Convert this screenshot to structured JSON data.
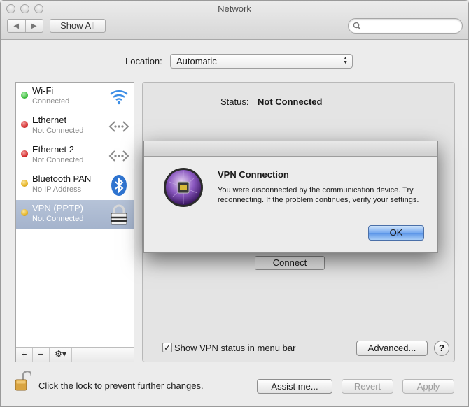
{
  "window": {
    "title": "Network"
  },
  "toolbar": {
    "back_glyph": "◀",
    "forward_glyph": "▶",
    "show_all": "Show All",
    "search_placeholder": ""
  },
  "location": {
    "label": "Location:",
    "value": "Automatic"
  },
  "services": [
    {
      "name": "Wi-Fi",
      "status": "Connected",
      "dot_color": "#3fbf3f",
      "icon": "wifi-icon"
    },
    {
      "name": "Ethernet",
      "status": "Not Connected",
      "dot_color": "#d62d2d",
      "icon": "ethernet-icon"
    },
    {
      "name": "Ethernet 2",
      "status": "Not Connected",
      "dot_color": "#d62d2d",
      "icon": "ethernet-icon"
    },
    {
      "name": "Bluetooth PAN",
      "status": "No IP Address",
      "dot_color": "#e6b422",
      "icon": "bluetooth-icon"
    },
    {
      "name": "VPN (PPTP)",
      "status": "Not Connected",
      "dot_color": "#e6b422",
      "icon": "vpn-lock-icon"
    }
  ],
  "selected_service": 4,
  "sidebar_buttons": {
    "add": "+",
    "remove": "−",
    "action": "⚙▾"
  },
  "detail": {
    "status_label": "Status:",
    "status_value": "Not Connected",
    "connect_button": "Connect",
    "show_vpn_status": "Show VPN status in menu bar",
    "show_vpn_checked": "✓",
    "advanced_button": "Advanced...",
    "help_button": "?"
  },
  "footer": {
    "lock_text": "Click the lock to prevent further changes.",
    "assist_button": "Assist me...",
    "revert_button": "Revert",
    "apply_button": "Apply"
  },
  "dialog": {
    "title": "VPN Connection",
    "message": "You were disconnected by the communication device. Try reconnecting. If the problem continues, verify your settings.",
    "ok_button": "OK"
  }
}
